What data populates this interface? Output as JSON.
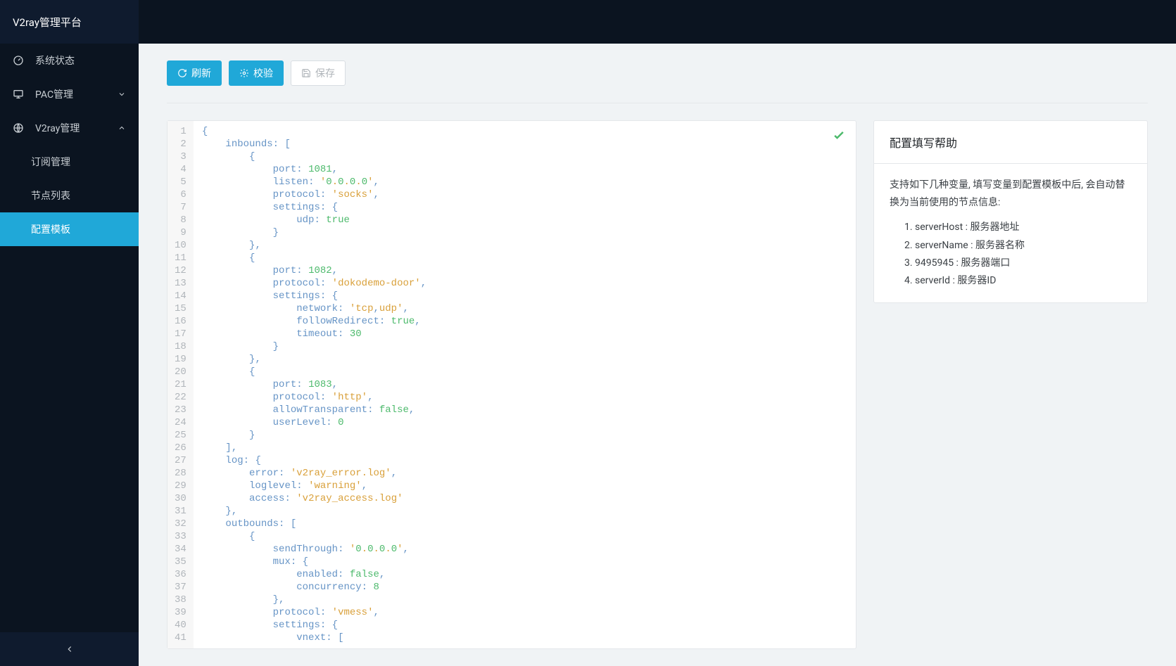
{
  "brand": "V2ray管理平台",
  "sidebar": {
    "items": [
      {
        "label": "系统状态",
        "icon": "gauge"
      },
      {
        "label": "PAC管理",
        "icon": "monitor",
        "expandable": true,
        "expanded": false
      },
      {
        "label": "V2ray管理",
        "icon": "globe",
        "expandable": true,
        "expanded": true,
        "children": [
          {
            "label": "订阅管理"
          },
          {
            "label": "节点列表"
          },
          {
            "label": "配置模板",
            "active": true
          }
        ]
      }
    ]
  },
  "toolbar": {
    "refresh_label": "刷新",
    "validate_label": "校验",
    "save_label": "保存"
  },
  "editor": {
    "valid": true,
    "code_raw": "{\n    inbounds: [\n        {\n            port: 1081,\n            listen: '0.0.0.0',\n            protocol: 'socks',\n            settings: {\n                udp: true\n            }\n        },\n        {\n            port: 1082,\n            protocol: 'dokodemo-door',\n            settings: {\n                network: 'tcp,udp',\n                followRedirect: true,\n                timeout: 30\n            }\n        },\n        {\n            port: 1083,\n            protocol: 'http',\n            allowTransparent: false,\n            userLevel: 0\n        }\n    ],\n    log: {\n        error: 'v2ray_error.log',\n        loglevel: 'warning',\n        access: 'v2ray_access.log'\n    },\n    outbounds: [\n        {\n            sendThrough: '0.0.0.0',\n            mux: {\n                enabled: false,\n                concurrency: 8\n            },\n            protocol: 'vmess',\n            settings: {\n                vnext: ["
  },
  "help": {
    "title": "配置填写帮助",
    "intro": "支持如下几种变量, 填写变量到配置模板中后, 会自动替换为当前使用的节点信息:",
    "vars": [
      "serverHost : 服务器地址",
      "serverName : 服务器名称",
      "9495945 : 服务器端口",
      "serverId : 服务器ID"
    ]
  }
}
